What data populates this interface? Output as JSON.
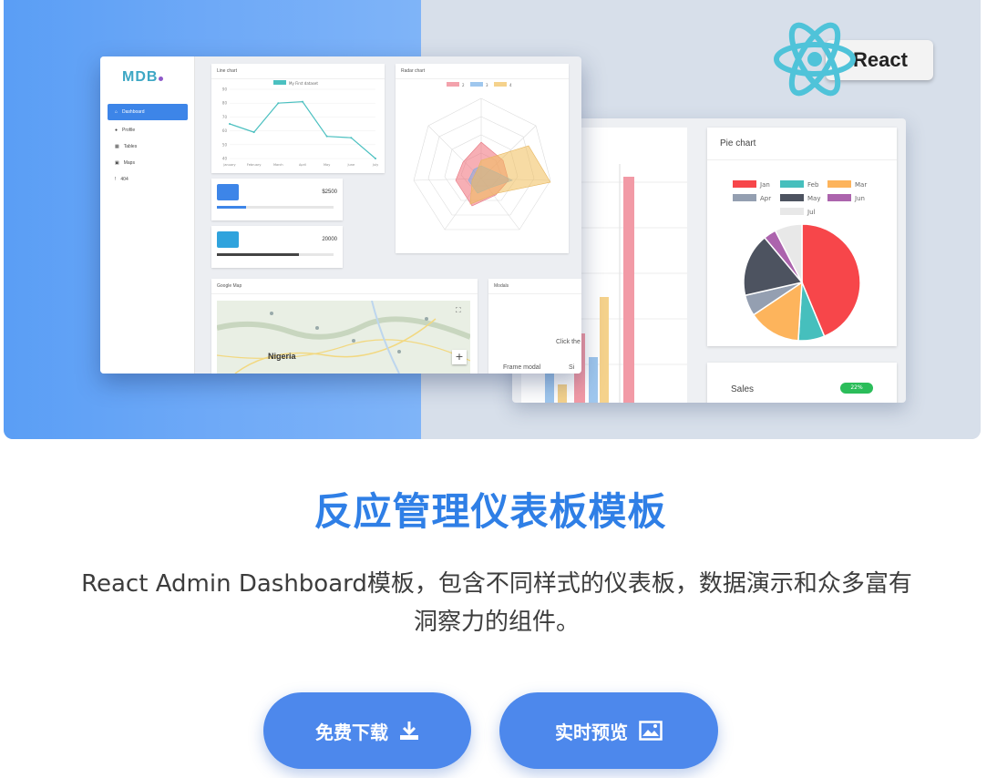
{
  "hero": {
    "react_badge": {
      "label": "React"
    },
    "dashboard": {
      "logo": "MDB",
      "sidebar": [
        {
          "label": "Dashboard",
          "icon": "home-icon",
          "active": true
        },
        {
          "label": "Profile",
          "icon": "user-icon",
          "active": false
        },
        {
          "label": "Tables",
          "icon": "table-icon",
          "active": false
        },
        {
          "label": "Maps",
          "icon": "map-icon",
          "active": false
        },
        {
          "label": "404",
          "icon": "warning-icon",
          "active": false
        }
      ],
      "line_chart": {
        "title": "Line chart",
        "chart_data": {
          "type": "line",
          "legend": "My First dataset",
          "categories": [
            "January",
            "February",
            "March",
            "April",
            "May",
            "June",
            "July"
          ],
          "series": [
            {
              "name": "My First dataset",
              "values": [
                65,
                59,
                80,
                81,
                56,
                55,
                40
              ]
            }
          ],
          "ylim": [
            40,
            90
          ],
          "color": "#4bc0c0"
        }
      },
      "radar_chart": {
        "title": "Radar chart",
        "legend": [
          "2",
          "3",
          "4"
        ]
      },
      "stat_cards": [
        {
          "value": "$2500",
          "fill_fraction": 0.25,
          "color": "#3d85e8"
        },
        {
          "value": "20000",
          "fill_fraction": 0.7,
          "color": "#444444"
        }
      ],
      "map": {
        "title": "Google Map",
        "label": "Nigeria",
        "zoom": "+"
      },
      "modal": {
        "title": "Modals",
        "frame_modal": "Frame modal",
        "click_text": "Click the",
        "short_text": "Si"
      }
    },
    "charts_window": {
      "pie": {
        "title": "Pie chart",
        "chart_data": {
          "type": "pie",
          "categories": [
            "Jan",
            "Feb",
            "Mar",
            "Apr",
            "May",
            "Jun",
            "Jul"
          ],
          "values": [
            300,
            50,
            100,
            40,
            120,
            24,
            52
          ],
          "colors": [
            "#f7464a",
            "#46bfbd",
            "#fdb45c",
            "#949fb1",
            "#4d5360",
            "#ac64ad",
            "#e8e8e8"
          ]
        }
      },
      "sales": {
        "label": "Sales",
        "badge": "22%"
      }
    }
  },
  "title": "反应管理仪表板模板",
  "description_line1": "React Admin Dashboard模板，包含不同样式的仪表板，数据演示和众多富有",
  "description_line2": "洞察力的组件。",
  "buttons": {
    "download": "免费下载",
    "preview": "实时预览"
  }
}
